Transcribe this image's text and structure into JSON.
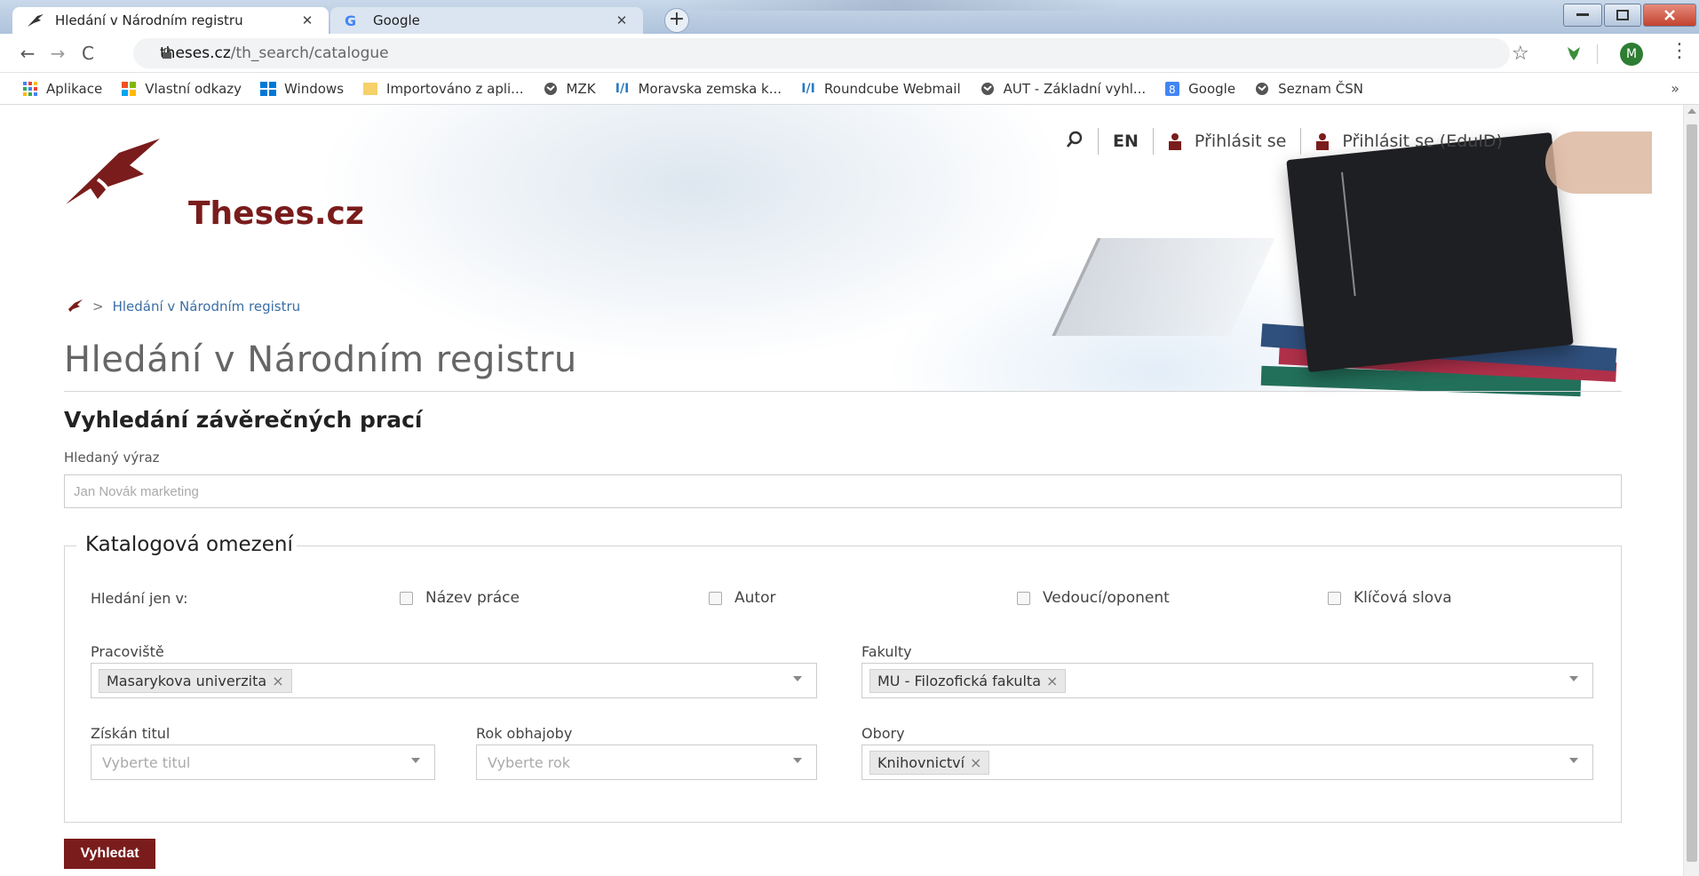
{
  "browser": {
    "tabs": [
      {
        "label": "Hledání v Národním registru",
        "active": true
      },
      {
        "label": "Google",
        "active": false
      }
    ],
    "new_tab_label": "+",
    "url_host": "theses.cz",
    "url_path": "/th_search/catalogue",
    "profile_initial": "M",
    "bookmarks": [
      {
        "label": "Aplikace",
        "icon": "apps-grid-icon"
      },
      {
        "label": "Vlastní odkazy",
        "icon": "windows-logo-icon"
      },
      {
        "label": "Windows",
        "icon": "windows-logo-icon"
      },
      {
        "label": "Importováno z apli...",
        "icon": "folder-icon"
      },
      {
        "label": "MZK",
        "icon": "globe-icon"
      },
      {
        "label": "Moravska zemska k...",
        "icon": "mzk-logo-icon"
      },
      {
        "label": "Roundcube Webmail",
        "icon": "mzk-logo-icon"
      },
      {
        "label": "AUT - Základní vyhl...",
        "icon": "globe-icon"
      },
      {
        "label": "Google",
        "icon": "google-icon"
      },
      {
        "label": "Seznam ČSN",
        "icon": "globe-icon"
      }
    ],
    "bookmarks_more": "»"
  },
  "topnav": {
    "lang": "EN",
    "login": "Přihlásit se",
    "login_eduid": "Přihlásit se (EduID)"
  },
  "logo_text": "Theses.cz",
  "breadcrumb": {
    "current": "Hledání v Národním registru",
    "separator": ">"
  },
  "page_title": "Hledání v Národním registru",
  "section_heading": "Vyhledání závěrečných prací",
  "search": {
    "label": "Hledaný výraz",
    "placeholder": "Jan Novák marketing",
    "value": ""
  },
  "filters": {
    "legend": "Katalogová omezení",
    "search_only_label": "Hledání jen v:",
    "checkboxes": [
      {
        "label": "Název práce",
        "checked": false
      },
      {
        "label": "Autor",
        "checked": false
      },
      {
        "label": "Vedoucí/oponent",
        "checked": false
      },
      {
        "label": "Klíčová slova",
        "checked": false
      }
    ],
    "pracoviste": {
      "label": "Pracoviště",
      "selected": "Masarykova univerzita"
    },
    "fakulty": {
      "label": "Fakulty",
      "selected": "MU - Filozofická fakulta"
    },
    "titul": {
      "label": "Získán titul",
      "placeholder": "Vyberte titul"
    },
    "rok": {
      "label": "Rok obhajoby",
      "placeholder": "Vyberte rok"
    },
    "obory": {
      "label": "Obory",
      "selected": "Knihovnictví"
    },
    "chip_remove": "×"
  },
  "submit_label": "Vyhledat",
  "colors": {
    "brand": "#7a1c1c",
    "link": "#3a6ea5"
  }
}
